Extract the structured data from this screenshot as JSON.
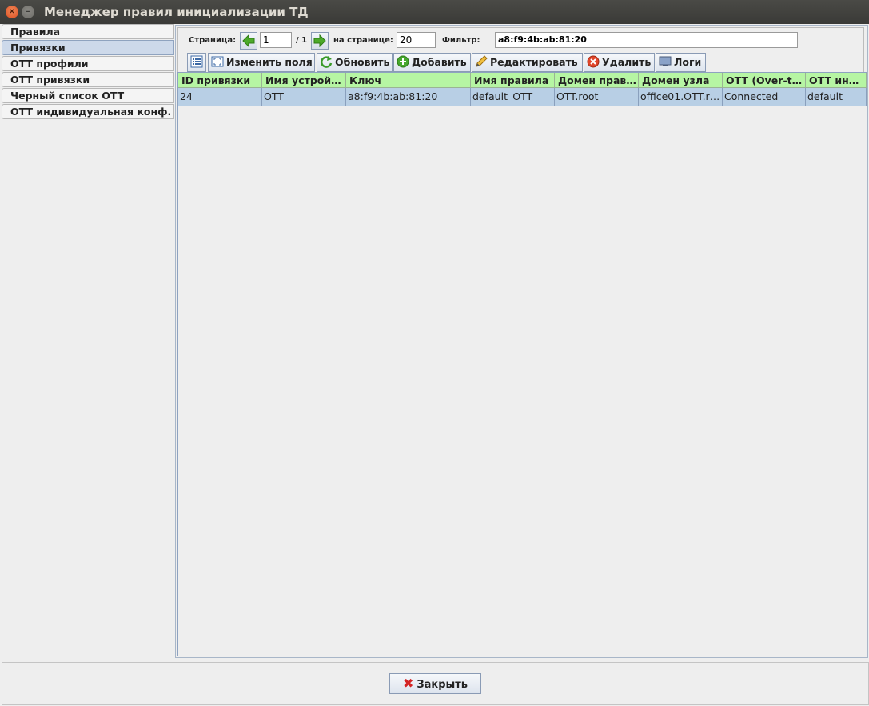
{
  "window": {
    "title": "Менеджер правил инициализации ТД"
  },
  "sidebar": {
    "items": [
      {
        "label": "Правила"
      },
      {
        "label": "Привязки",
        "active": true
      },
      {
        "label": "OTT профили"
      },
      {
        "label": "OTT привязки"
      },
      {
        "label": "Черный список OTT"
      },
      {
        "label": "OTT индивидуальная конф."
      }
    ]
  },
  "pager": {
    "page_label": "Страница:",
    "page_value": "1",
    "total": "/ 1",
    "per_page_label": "на странице:",
    "per_page_value": "20",
    "filter_label": "Фильтр:",
    "filter_value": "a8:f9:4b:ab:81:20"
  },
  "toolbar": {
    "change_fields": "Изменить поля",
    "refresh": "Обновить",
    "add": "Добавить",
    "edit": "Редактировать",
    "delete": "Удалить",
    "logs": "Логи"
  },
  "table": {
    "columns": [
      "ID привязки",
      "Имя устрой…",
      "Ключ",
      "Имя правила",
      "Домен прав…",
      "Домен узла",
      "OTT (Over-t…",
      "OTT ин…"
    ],
    "rows": [
      [
        "24",
        "OTT",
        "a8:f9:4b:ab:81:20",
        "default_OTT",
        "OTT.root",
        "office01.OTT.r…",
        "Connected",
        "default"
      ]
    ]
  },
  "footer": {
    "close": "Закрыть"
  },
  "colors": {
    "header_green": "#b6f5a3",
    "selected_row": "#b8cfe5",
    "titlebar": "#3c3b37"
  }
}
